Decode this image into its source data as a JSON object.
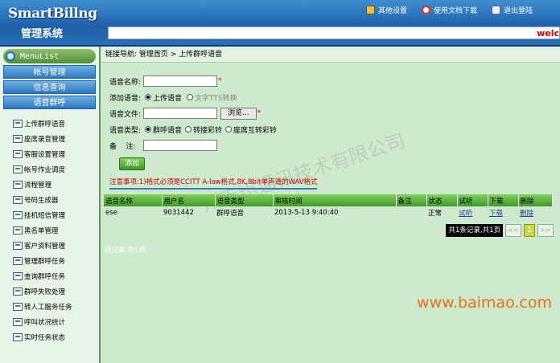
{
  "header": {
    "logo_en": "SmartBillng",
    "logo_cn": "管理系统",
    "links": [
      {
        "label": "其他设置",
        "icon": "settings-icon"
      },
      {
        "label": "使用文档下载",
        "icon": "help-icon"
      },
      {
        "label": "退出登陆",
        "icon": "logout-icon"
      }
    ],
    "marquee": "welc"
  },
  "sidebar": {
    "title": "MenuList",
    "buttons": [
      "帐号管理",
      "信息查询",
      "语音群呼"
    ],
    "items": [
      "上传群呼语音",
      "座席录音管理",
      "客服设置管理",
      "帐号作业调度",
      "流程管理",
      "号码生成器",
      "挂机短信管理",
      "黑名单管理",
      "客户资料管理",
      "管理群呼任务",
      "查询群呼任务",
      "群呼失败处理",
      "转人工服务任务",
      "呼叫状况统计",
      "实时任务状态"
    ]
  },
  "breadcrumb": "链接导航: 管理首页 > 上传群呼语音",
  "form": {
    "name_label": "语音名称:",
    "add_label": "添加语音:",
    "add_options": [
      "上传语音",
      "文字TTS转换"
    ],
    "file_label": "语音文件:",
    "browse_label": "浏览...",
    "type_label": "语音类型:",
    "type_options": [
      "群呼语音",
      "转接彩铃",
      "座席互转彩铃"
    ],
    "note_label": "备    注:",
    "submit_label": "添加",
    "notice": "注意事项:1)格式必须是CCITT A-law格式,8K,8bit单声道的WAV格式"
  },
  "watermark": "广州市迅通讯技术有限公司",
  "table": {
    "headers": [
      "语音名称",
      "用户名",
      "语音类型",
      "审核时间",
      "备注",
      "状态",
      "试听",
      "下载",
      "删除"
    ],
    "rows": [
      [
        "ese",
        "9031442",
        "群呼语音",
        "2013-5-13 9:40:40",
        "",
        "正常",
        "试听",
        "下载",
        "删除"
      ]
    ]
  },
  "pager": {
    "info": "共1条记录,共1页",
    "prev": "<<",
    "current": "1",
    "next": ">>"
  },
  "summary": "总记录:共1页",
  "brand": "www.baimao.com"
}
